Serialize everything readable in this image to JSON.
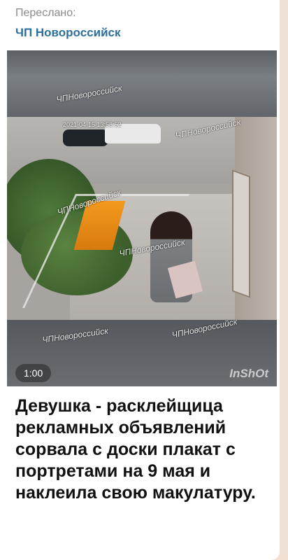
{
  "message": {
    "forwarded_label": "Переслано:",
    "channel_name": "ЧП Новороссийск",
    "caption": "Девушка - расклейщица рекламных объявлений сорвала с доски плакат с портретами на 9 мая и наклеила свою макулатуру."
  },
  "video": {
    "duration": "1:00",
    "app_watermark": "InShOt",
    "overlay_watermark": "ЧПНовороссийск",
    "timestamp_text": "2021-04-15 13:58:52"
  },
  "colors": {
    "channel": "#2c6f9e",
    "bubble": "#ffffff",
    "background": "#f0e1d4"
  }
}
